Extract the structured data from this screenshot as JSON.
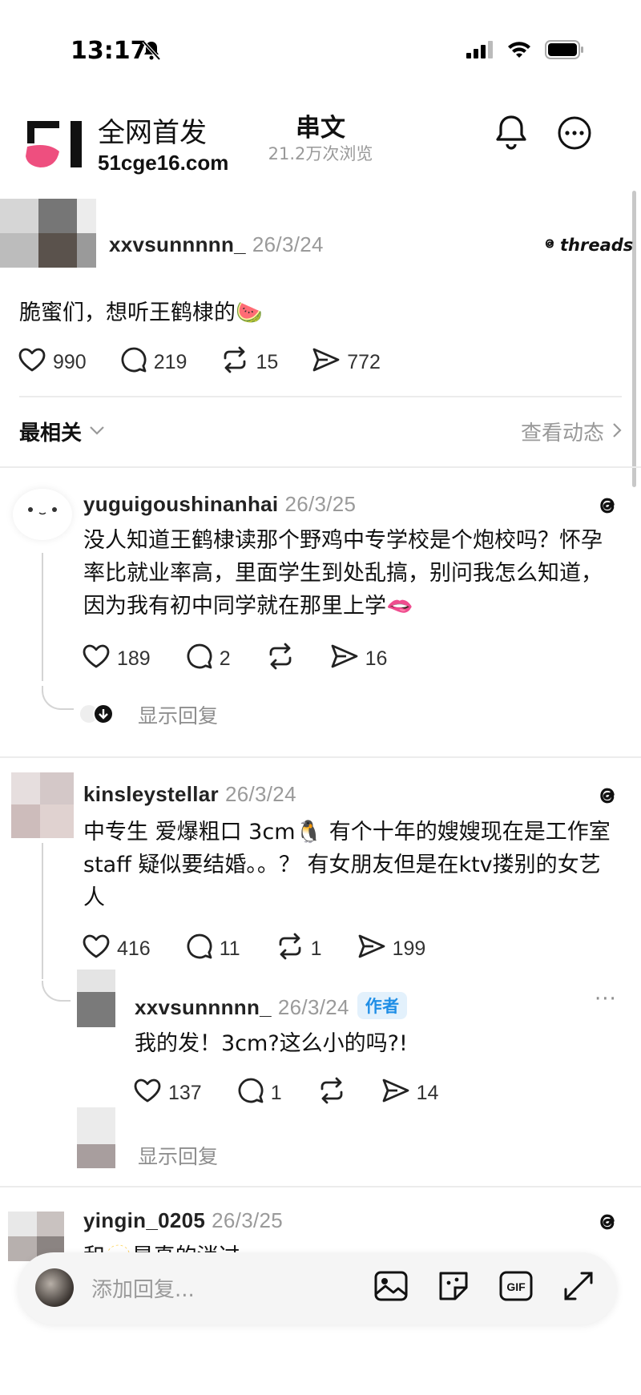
{
  "status_bar": {
    "time": "13:17"
  },
  "watermark": {
    "logo_text": "51",
    "line1": "全网首发",
    "line2": "51cge16.com"
  },
  "header": {
    "title": "串文",
    "views": "21.2万次浏览"
  },
  "original_post": {
    "username": "xxvsunnnnn_",
    "date": "26/3/24",
    "brand": "threads",
    "text": "脆蜜们，想听王鹤棣的🍉",
    "likes": "990",
    "comments": "219",
    "reposts": "15",
    "shares": "772"
  },
  "sort_bar": {
    "label": "最相关",
    "activity": "查看动态"
  },
  "comments": [
    {
      "username": "yuguigoushinanhai",
      "date": "26/3/25",
      "text": "没人知道王鹤棣读那个野鸡中专学校是个炮校吗？怀孕率比就业率高，里面学生到处乱搞，别问我怎么知道，因为我有初中同学就在那里上学🫦",
      "likes": "189",
      "comments": "2",
      "reposts": "",
      "shares": "16",
      "show_replies": "显示回复"
    },
    {
      "username": "kinsleystellar",
      "date": "26/3/24",
      "text": "中专生 爱爆粗口 3cm🐧 有个十年的嫂嫂现在是工作室staff 疑似要结婚。。？ 有女朋友但是在ktv搂别的女艺人",
      "likes": "416",
      "comments": "11",
      "reposts": "1",
      "shares": "199",
      "reply": {
        "username": "xxvsunnnnn_",
        "date": "26/3/24",
        "badge": "作者",
        "more": "···",
        "text": "我的发！3cm?这么小的吗?!",
        "likes": "137",
        "comments": "1",
        "reposts": "",
        "shares": "14"
      },
      "show_replies": "显示回复"
    },
    {
      "username": "yingin_0205",
      "date": "26/3/25",
      "text": "和🫥是真的消过"
    }
  ],
  "composer": {
    "placeholder": "添加回复..."
  },
  "colors": {
    "accent_blue": "#1f8ee6",
    "watermark_pink": "#ee4f7f",
    "muted": "#9a9a9a"
  }
}
